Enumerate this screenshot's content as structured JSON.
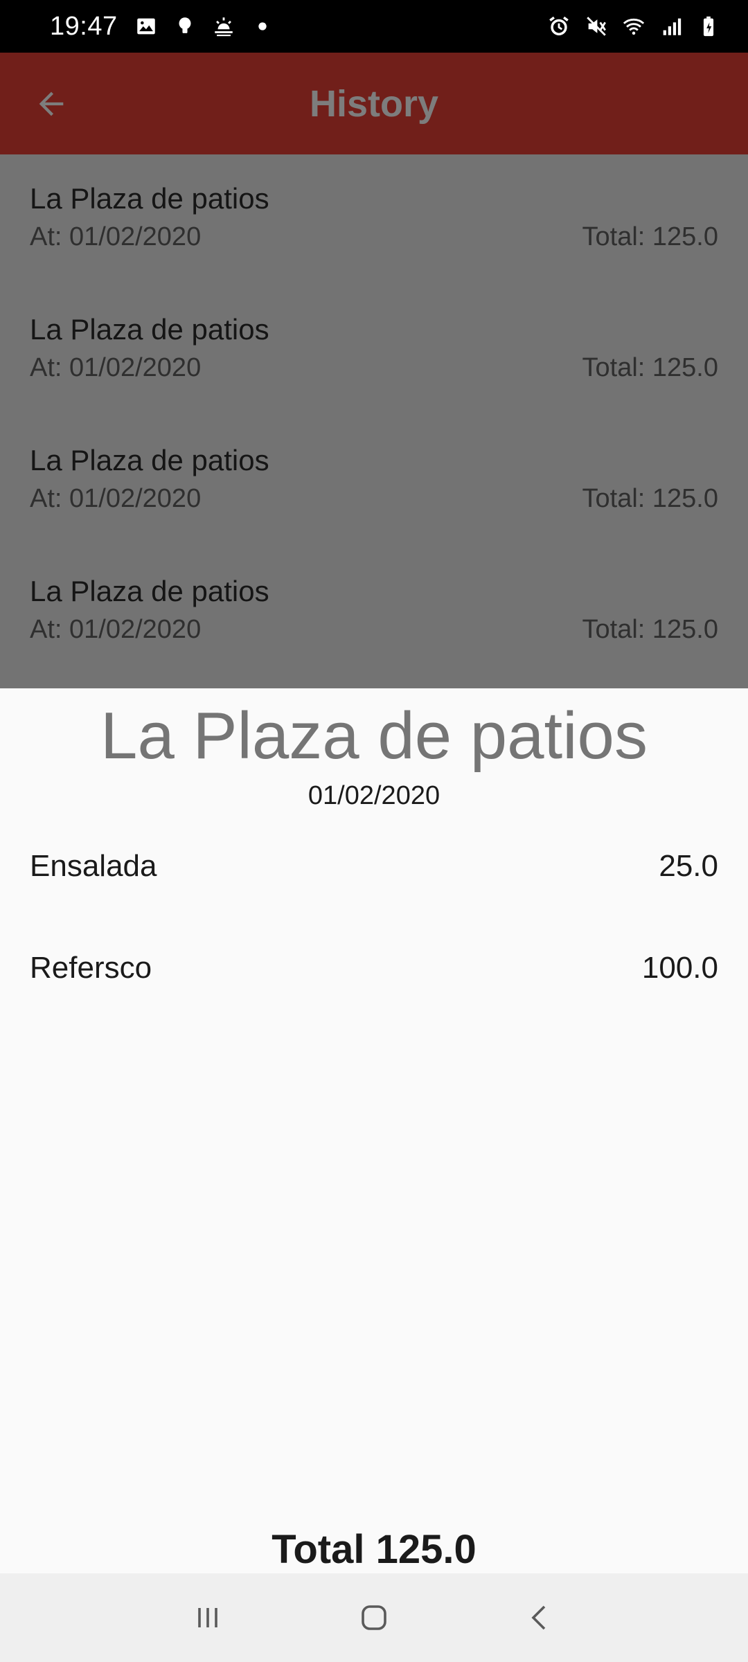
{
  "status_bar": {
    "time": "19:47",
    "left_icons": [
      "image-icon",
      "bulb-icon",
      "weather-icon",
      "dot-icon"
    ],
    "right_icons": [
      "alarm-icon",
      "mute-icon",
      "wifi-icon",
      "signal-icon",
      "battery-icon"
    ]
  },
  "app_bar": {
    "title": "History",
    "background": "#711f1a"
  },
  "history": {
    "items": [
      {
        "name": "La Plaza de patios",
        "date": "At:  01/02/2020",
        "total": "Total:  125.0"
      },
      {
        "name": "La Plaza de patios",
        "date": "At:  01/02/2020",
        "total": "Total:  125.0"
      },
      {
        "name": "La Plaza de patios",
        "date": "At:  01/02/2020",
        "total": "Total:  125.0"
      },
      {
        "name": "La Plaza de patios",
        "date": "At:  01/02/2020",
        "total": "Total:  125.0"
      }
    ]
  },
  "detail": {
    "title": "La Plaza de patios",
    "date": "01/02/2020",
    "items": [
      {
        "name": "Ensalada",
        "price": "25.0"
      },
      {
        "name": "Refersco",
        "price": "100.0"
      }
    ],
    "total": "Total 125.0"
  },
  "nav_bar": {
    "buttons": [
      "recents-icon",
      "home-icon",
      "back-icon"
    ]
  }
}
